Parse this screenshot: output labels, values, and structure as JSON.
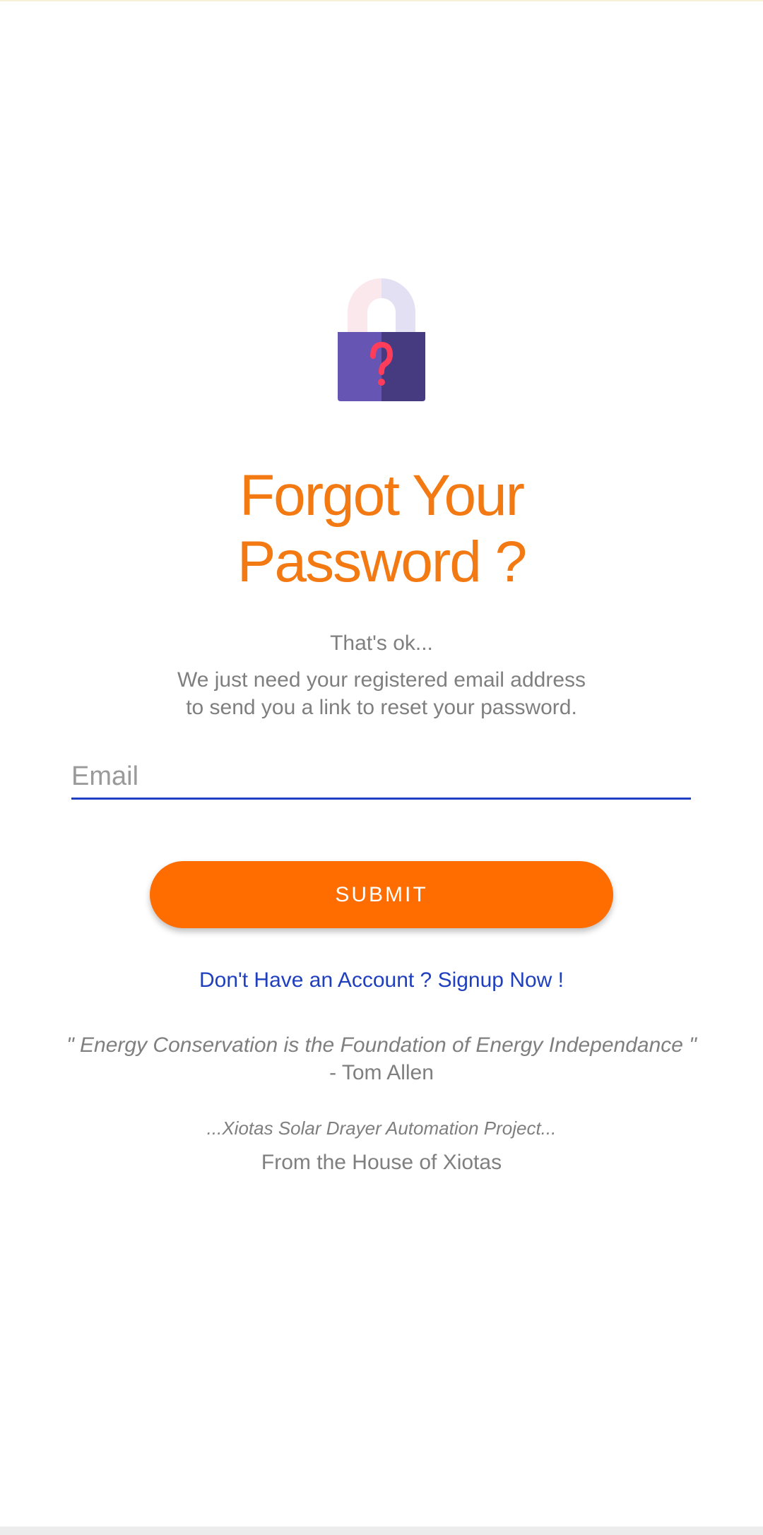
{
  "colors": {
    "accent": "#ff6d00",
    "title": "#f37a12",
    "link": "#1f3fbf",
    "input_underline": "#1f3fc4",
    "muted_text": "#7f7f7f",
    "lock_body_light": "#6655b3",
    "lock_body_dark": "#463a80",
    "lock_question_mark": "#ff3d5a"
  },
  "header": {
    "icon": "lock-question-icon",
    "title_line1": "Forgot Your",
    "title_line2": "Password ?"
  },
  "message": {
    "subtitle": "That's ok...",
    "line1": "We just need your registered email address",
    "line2": "to send you a link to reset your password."
  },
  "form": {
    "email_placeholder": "Email",
    "email_value": "",
    "submit_label": "SUBMIT"
  },
  "signup_link": "Don't Have an Account ? Signup Now !",
  "footer": {
    "quote": "\" Energy Conservation is the Foundation of Energy Independance \"",
    "quote_author": "- Tom Allen",
    "project": "...Xiotas Solar Drayer Automation Project...",
    "credit": "From the House of Xiotas"
  }
}
